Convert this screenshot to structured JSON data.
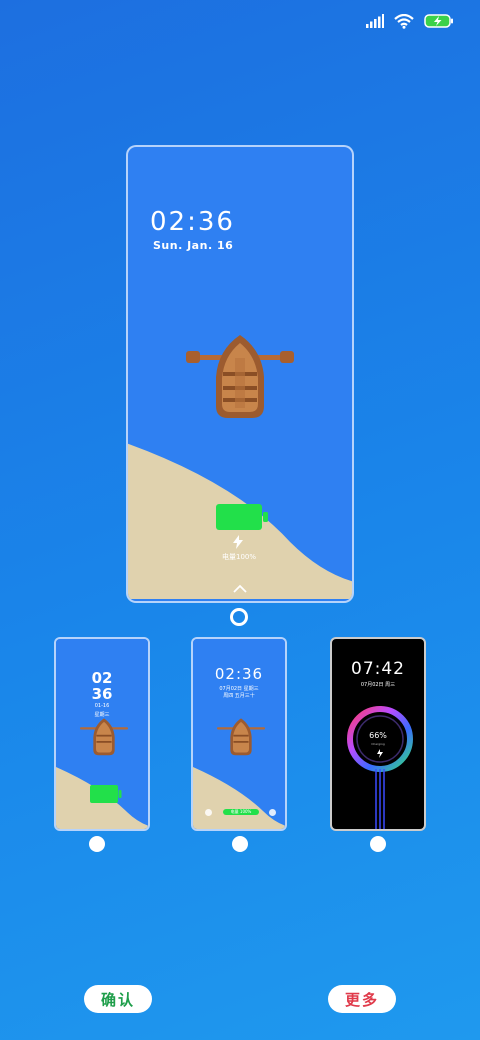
{
  "status_bar": {
    "icons": [
      "signal-icon",
      "wifi-icon",
      "battery-charging-icon"
    ],
    "battery_color": "#3bd14a"
  },
  "preview_large": {
    "time": "02:36",
    "date": "Sun. Jan. 16",
    "battery_level_text": "电量100%",
    "battery_color": "#22e04a",
    "sand_color": "#e0d2ae",
    "sky_color": "#2f80f2"
  },
  "thumbnails": [
    {
      "hour": "02",
      "minute": "36",
      "date": "01-16",
      "weekday": "星期三"
    },
    {
      "time": "02:36",
      "line1": "07月02日 星期三",
      "line2": "周四 五月三十",
      "battery_text": "电量 100%"
    },
    {
      "time": "07:42",
      "date": "07月02日 周三",
      "percent": "66%",
      "sub": "Charging"
    }
  ],
  "buttons": {
    "confirm": "确认",
    "more": "更多"
  }
}
